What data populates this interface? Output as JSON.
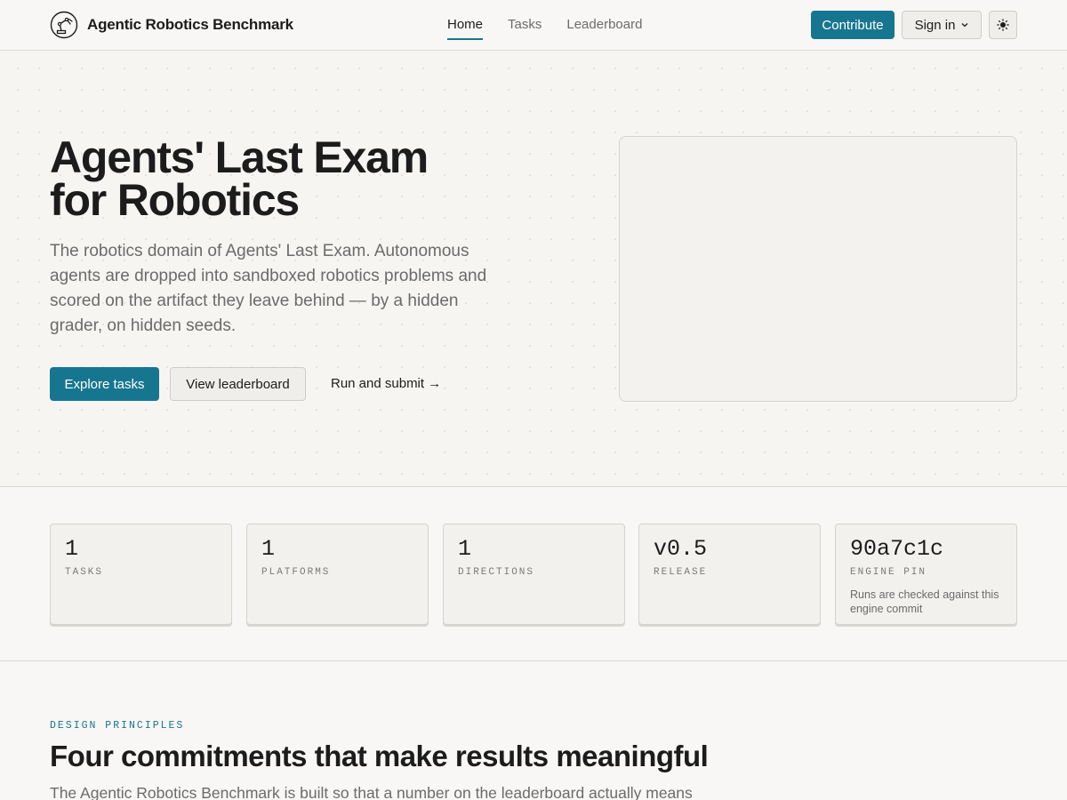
{
  "brand": {
    "name": "Agentic Robotics Benchmark",
    "logo_icon": "robot-arm-icon"
  },
  "nav": {
    "items": [
      {
        "label": "Home",
        "active": true
      },
      {
        "label": "Tasks",
        "active": false
      },
      {
        "label": "Leaderboard",
        "active": false
      }
    ]
  },
  "header": {
    "contribute_label": "Contribute",
    "signin_label": "Sign in",
    "theme_icon": "sun-icon"
  },
  "hero": {
    "title_line1": "Agents' Last Exam",
    "title_line2": "for Robotics",
    "description": "The robotics domain of Agents' Last Exam. Autonomous agents are dropped into sandboxed robotics problems and scored on the artifact they leave behind — by a hidden grader, on hidden seeds.",
    "primary_label": "Explore tasks",
    "secondary_label": "View leaderboard",
    "link_label": "Run and submit →"
  },
  "stats": [
    {
      "value": "1",
      "label": "TASKS",
      "note": ""
    },
    {
      "value": "1",
      "label": "PLATFORMS",
      "note": ""
    },
    {
      "value": "1",
      "label": "DIRECTIONS",
      "note": ""
    },
    {
      "value": "v0.5",
      "label": "RELEASE",
      "note": ""
    },
    {
      "value": "90a7c1c",
      "label": "ENGINE PIN",
      "note": "Runs are checked against this engine commit"
    }
  ],
  "principles": {
    "eyebrow": "DESIGN PRINCIPLES",
    "title": "Four commitments that make results meaningful",
    "description": "The Agentic Robotics Benchmark is built so that a number on the leaderboard actually means"
  },
  "colors": {
    "accent": "#17768f",
    "background": "#f8f7f5",
    "text": "#1c1c1c",
    "muted": "#6b6b6b"
  }
}
